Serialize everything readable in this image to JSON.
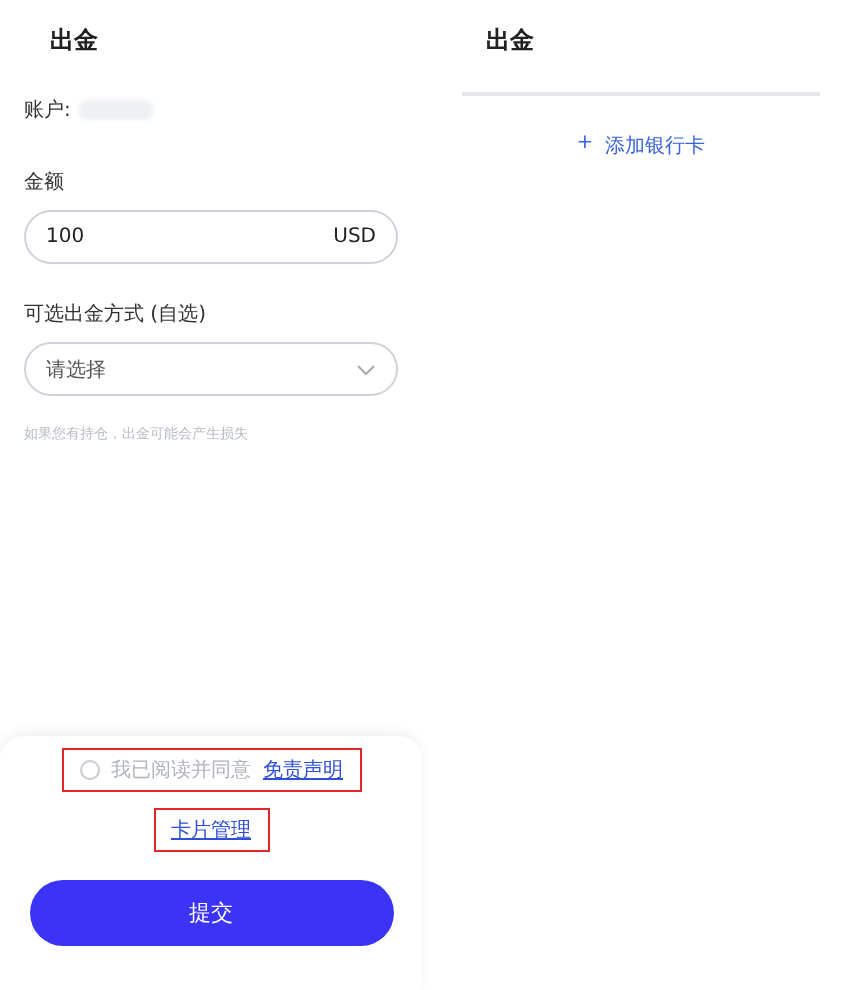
{
  "withdraw_form": {
    "title": "出金",
    "account": {
      "label": "账户:"
    },
    "amount": {
      "label": "金额",
      "value": "100",
      "unit": "USD"
    },
    "method": {
      "label": "可选出金方式 (自选)",
      "placeholder": "请选择"
    },
    "hint": "如果您有持仓，出金可能会产生损失",
    "agreement": {
      "text": "我已阅读并同意",
      "link": "免责声明",
      "checked": false,
      "highlighted": true
    },
    "card_management": {
      "label": "卡片管理",
      "highlighted": true
    },
    "submit": "提交"
  },
  "bank_cards": {
    "title": "出金",
    "add_card": "添加银行卡",
    "add_icon": "+"
  }
}
